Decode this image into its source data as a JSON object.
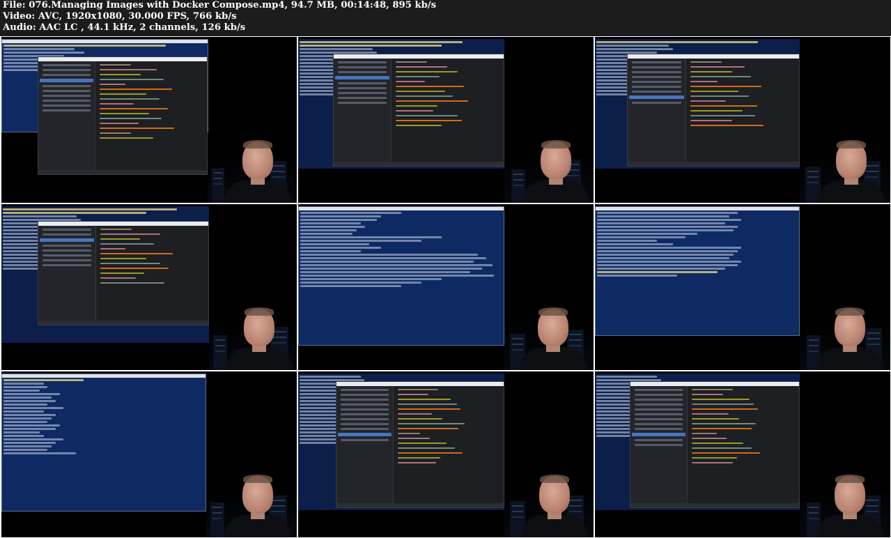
{
  "header": {
    "file_line": "File: 076.Managing Images with Docker Compose.mp4, 94.7 MB, 00:14:48, 895 kb/s",
    "video_line": "Video: AVC, 1920x1080, 30.000 FPS, 766 kb/s",
    "audio_line": "Audio: AAC LC , 44.1 kHz, 2 channels, 126 kb/s"
  },
  "thumbnails": [
    {
      "scene": "terminal-with-ide"
    },
    {
      "scene": "terminal-with-ide"
    },
    {
      "scene": "terminal-with-ide"
    },
    {
      "scene": "terminal-with-ide"
    },
    {
      "scene": "terminal-only"
    },
    {
      "scene": "terminal-only"
    },
    {
      "scene": "terminal-narrow"
    },
    {
      "scene": "terminal-with-ide-right"
    },
    {
      "scene": "terminal-with-ide-right"
    }
  ],
  "colors": {
    "header_bg": "#1c1c1c",
    "terminal_bg": "#0f2a63",
    "ide_bg": "#1e1f22",
    "selection": "#4a79c9"
  }
}
